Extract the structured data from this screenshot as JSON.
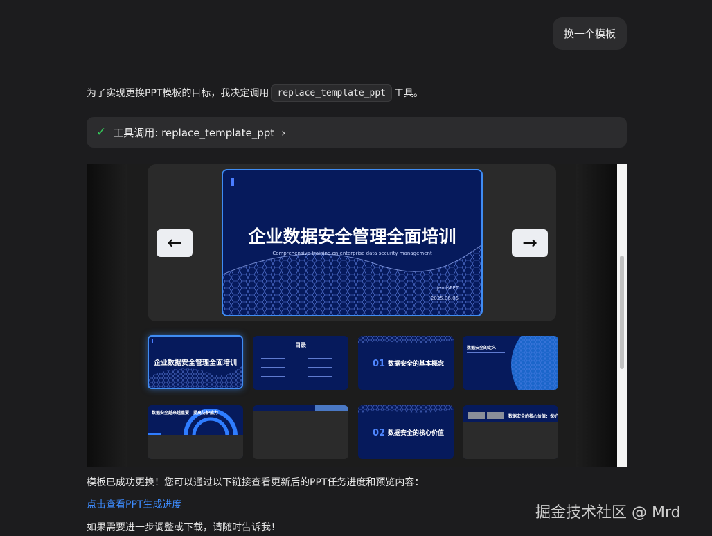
{
  "user_message": "换一个模板",
  "assistant": {
    "intro_before": "为了实现更换PPT模板的目标，我决定调用",
    "intro_code": "replace_template_ppt",
    "intro_after": "工具。",
    "tool_call": {
      "status_icon": "check-icon",
      "label": "工具调用: replace_template_ppt",
      "expand_icon": "chevron-right-icon"
    },
    "result_text": "模板已成功更换！您可以通过以下链接查看更新后的PPT任务进度和预览内容：",
    "link_text": "点击查看PPT生成进度",
    "followup_text": "如果需要进一步调整或下载，请随时告诉我！"
  },
  "preview": {
    "prev_label": "←",
    "next_label": "→",
    "main_slide": {
      "title": "企业数据安全管理全面培训",
      "subtitle": "Comprehensive training on enterprise data security management",
      "brand": "JenlisPPT",
      "date": "2025.06.06"
    },
    "thumbnails": [
      {
        "type": "cover",
        "title": "企业数据安全管理全面培训"
      },
      {
        "type": "toc",
        "title": "目录"
      },
      {
        "type": "section",
        "number": "01",
        "label": "数据安全的基本概念"
      },
      {
        "type": "content",
        "label": "数据安全的定义"
      },
      {
        "type": "content",
        "label": "数据安全越来越重要：提高防护能力"
      },
      {
        "type": "image",
        "label": ""
      },
      {
        "type": "section",
        "number": "02",
        "label": "数据安全的核心价值"
      },
      {
        "type": "content",
        "label": "数据安全的核心价值：保护客户信息"
      }
    ]
  },
  "watermark": "掘金技术社区 @ Mrd",
  "colors": {
    "background": "#1c1c1e",
    "bubble": "#2c2c2e",
    "accent": "#3f8cf3",
    "slide_bg": "#061a5c",
    "success": "#34c759",
    "link": "#3d8bfd"
  }
}
